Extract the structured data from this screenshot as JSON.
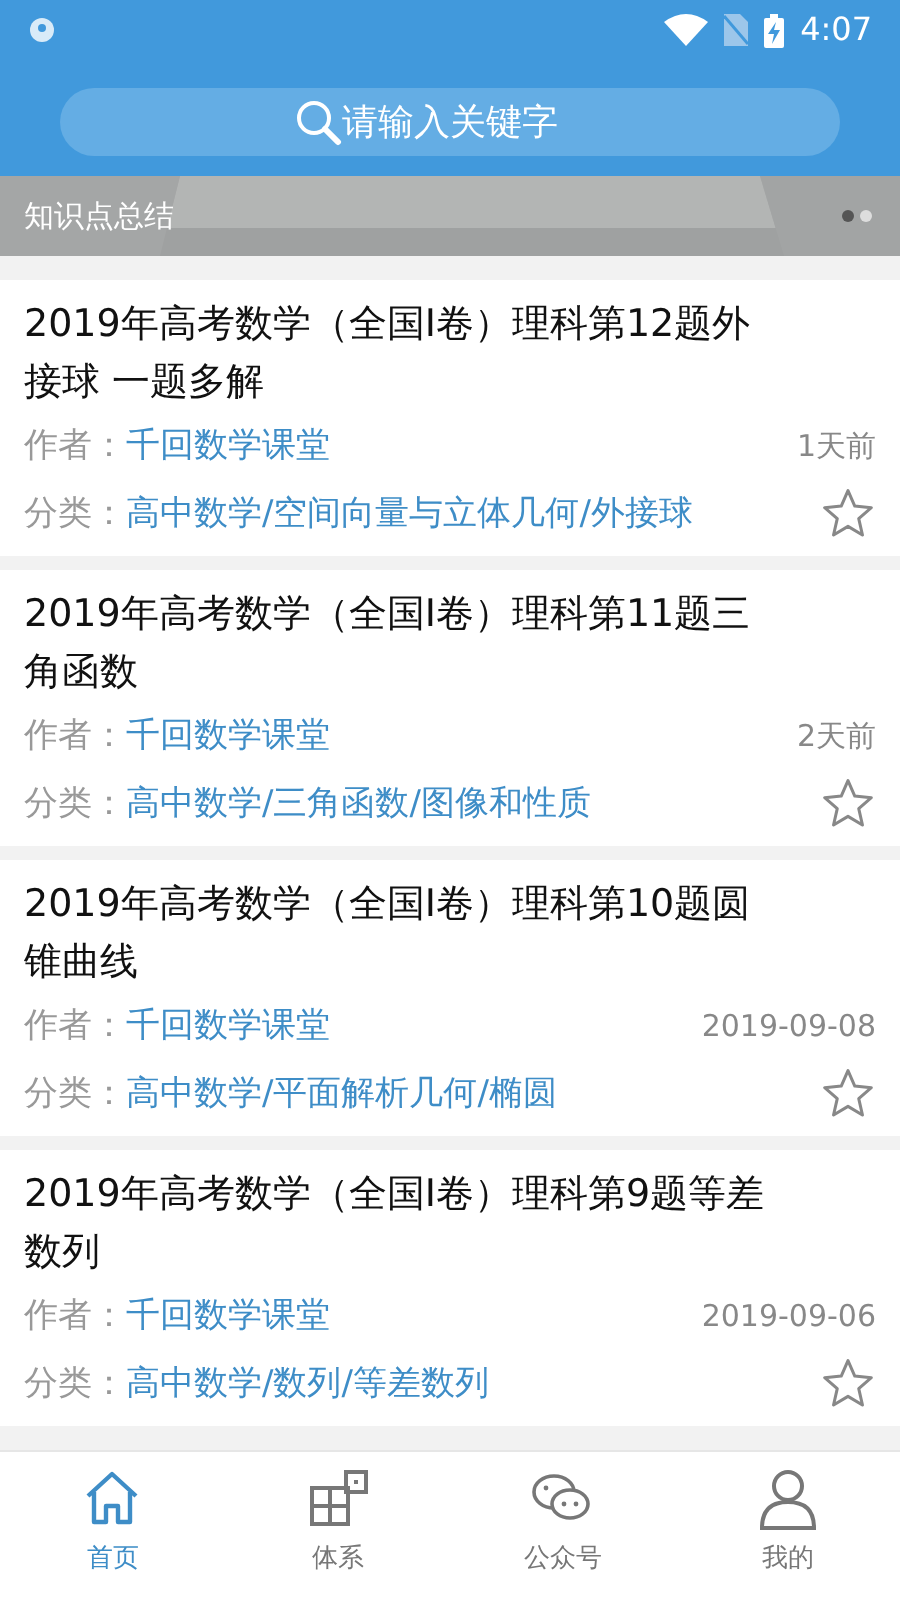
{
  "status_bar": {
    "time": "4:07"
  },
  "search": {
    "placeholder": "请输入关键字"
  },
  "banner": {
    "kind": "picture",
    "caption": "知识点总结",
    "dots": [
      {
        "selected": true
      },
      {
        "selected": false
      }
    ]
  },
  "articles": [
    {
      "title": "2019年高考数学（全国I卷）理科第12题外接球 一题多解",
      "author_label": "作者：",
      "author": "千回数学课堂",
      "date": "1天前",
      "category_label": "分类：",
      "category": "高中数学/空间向量与立体几何/外接球",
      "starred": false
    },
    {
      "title": "2019年高考数学（全国I卷）理科第11题三角函数",
      "author_label": "作者：",
      "author": "千回数学课堂",
      "date": "2天前",
      "category_label": "分类：",
      "category": "高中数学/三角函数/图像和性质",
      "starred": false
    },
    {
      "title": "2019年高考数学（全国I卷）理科第10题圆锥曲线",
      "author_label": "作者：",
      "author": "千回数学课堂",
      "date": "2019-09-08",
      "category_label": "分类：",
      "category": "高中数学/平面解析几何/椭圆",
      "starred": false
    },
    {
      "title": "2019年高考数学（全国I卷）理科第9题等差数列",
      "author_label": "作者：",
      "author": "千回数学课堂",
      "date": "2019-09-06",
      "category_label": "分类：",
      "category": "高中数学/数列/等差数列",
      "starred": false
    }
  ],
  "tabs": [
    {
      "kind": "home",
      "label": "首页",
      "selected": true
    },
    {
      "kind": "grid",
      "label": "体系",
      "selected": false
    },
    {
      "kind": "chat",
      "label": "公众号",
      "selected": false
    },
    {
      "kind": "person",
      "label": "我的",
      "selected": false
    }
  ]
}
